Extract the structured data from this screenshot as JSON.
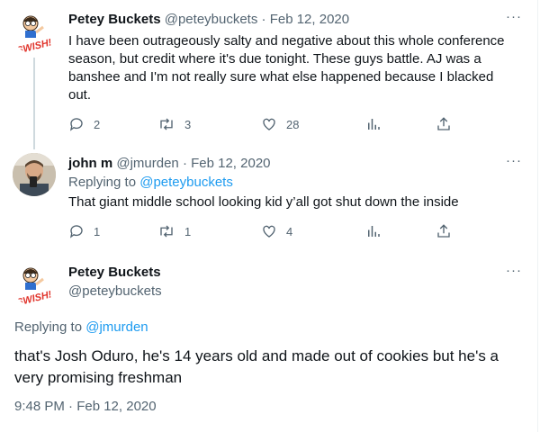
{
  "tweets": [
    {
      "display_name": "Petey Buckets",
      "handle": "@peteybuckets",
      "separator": "·",
      "date": "Feb 12, 2020",
      "text": "I have been outrageously salty and negative about this whole conference season, but credit where it's due tonight. These guys battle. AJ was a banshee and I'm not really sure what else happened because I blacked out.",
      "replies": "2",
      "retweets": "3",
      "likes": "28",
      "avatar_icon": "swish-mascot-logo"
    },
    {
      "display_name": "john m",
      "handle": "@jmurden",
      "separator": "·",
      "date": "Feb 12, 2020",
      "replying_prefix": "Replying to",
      "replying_to": "@peteybuckets",
      "text": "That giant middle school looking kid y’all got shut down the inside",
      "replies": "1",
      "retweets": "1",
      "likes": "4",
      "avatar_icon": "user-photo"
    }
  ],
  "focal_tweet": {
    "display_name": "Petey Buckets",
    "handle": "@peteybuckets",
    "replying_prefix": "Replying to",
    "replying_to": "@jmurden",
    "text": "that's Josh Oduro, he's 14 years old and made out of cookies but he's a very promising freshman",
    "timestamp": "9:48 PM · Feb 12, 2020",
    "avatar_icon": "swish-mascot-logo"
  },
  "more_label": "···",
  "avatar_logo_text": "SWISH!",
  "colors": {
    "link": "#1d9bf0",
    "muted": "#536471",
    "text": "#0f1419",
    "divider": "#eff3f4"
  },
  "icons": [
    "reply-icon",
    "retweet-icon",
    "like-icon",
    "views-icon",
    "share-icon",
    "more-icon"
  ]
}
